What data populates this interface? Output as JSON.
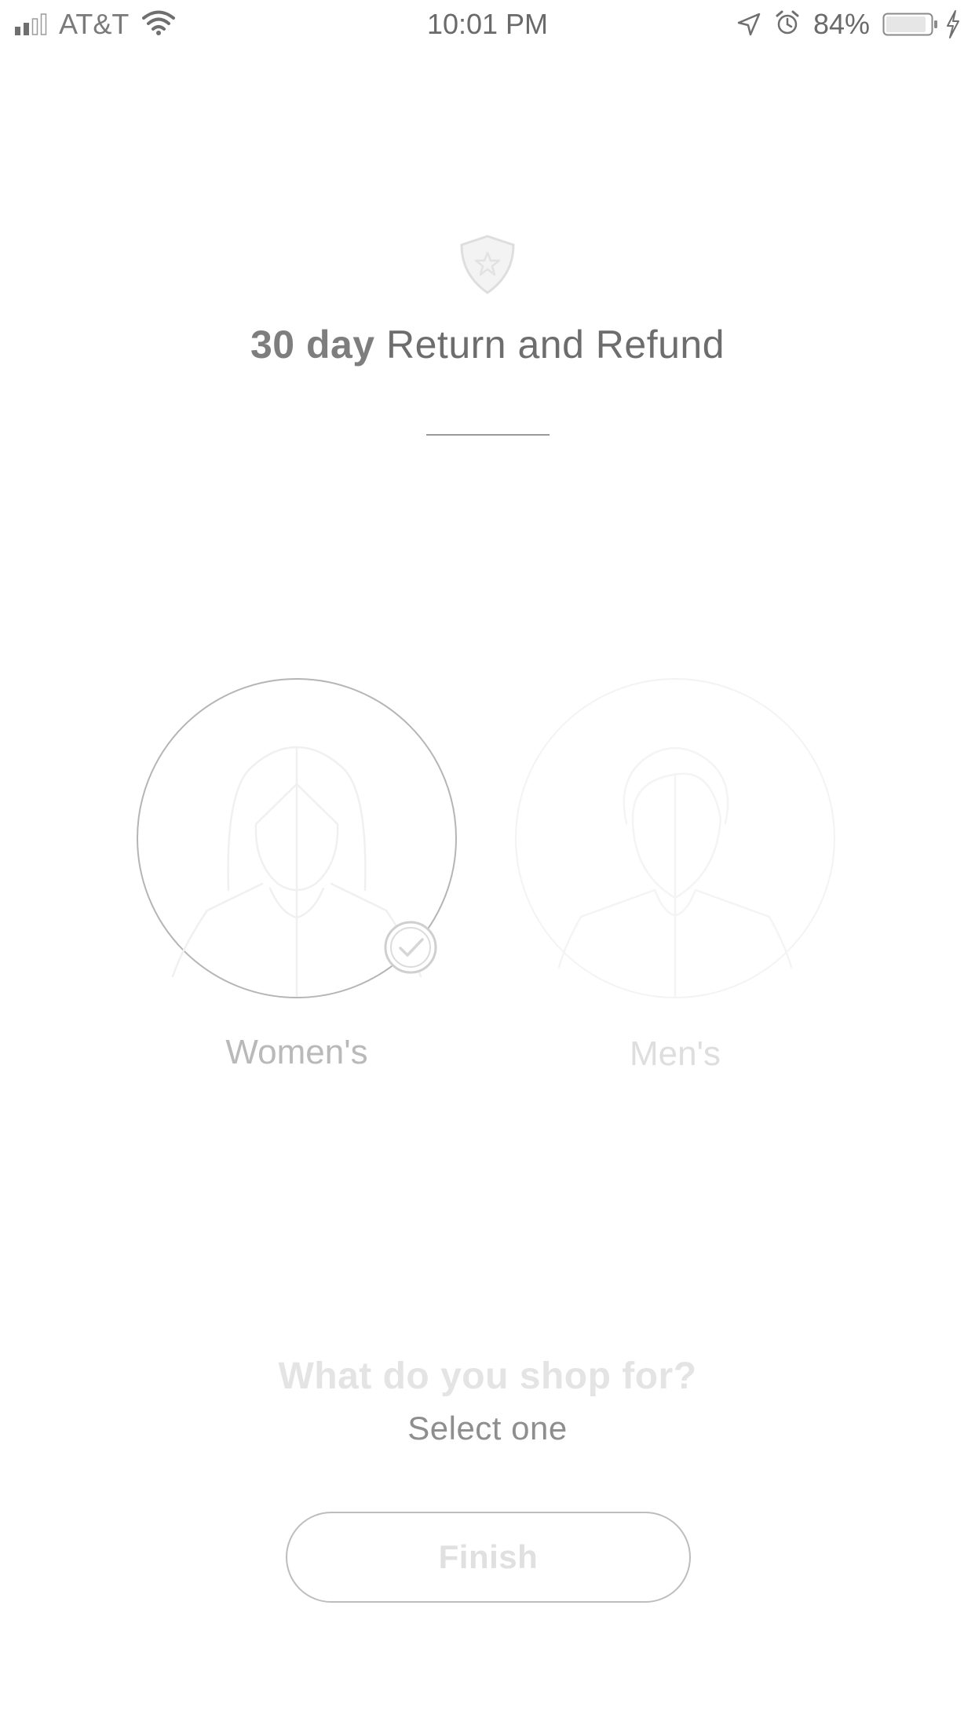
{
  "status_bar": {
    "carrier": "AT&T",
    "time": "10:01 PM",
    "battery_percent": "84%",
    "icons": [
      "signal-icon",
      "wifi-icon",
      "location-arrow-icon",
      "alarm-icon",
      "battery-icon",
      "charging-bolt-icon"
    ]
  },
  "header": {
    "icon": "shield-star-icon",
    "headline_bold": "30 day",
    "headline_rest": " Return and Refund"
  },
  "choices": [
    {
      "label": "Women's",
      "selected": true,
      "icon": "woman-avatar-icon"
    },
    {
      "label": "Men's",
      "selected": false,
      "icon": "man-avatar-icon"
    }
  ],
  "prompt": {
    "question": "What do you shop for?",
    "subtext": "Select one"
  },
  "finish_button": {
    "label": "Finish"
  },
  "colors": {
    "selected_ring": "#b5b5b5",
    "unselected_ring": "#f3f3f3",
    "text_dark": "#6d6d6d",
    "text_faint": "#e0e0e0"
  }
}
